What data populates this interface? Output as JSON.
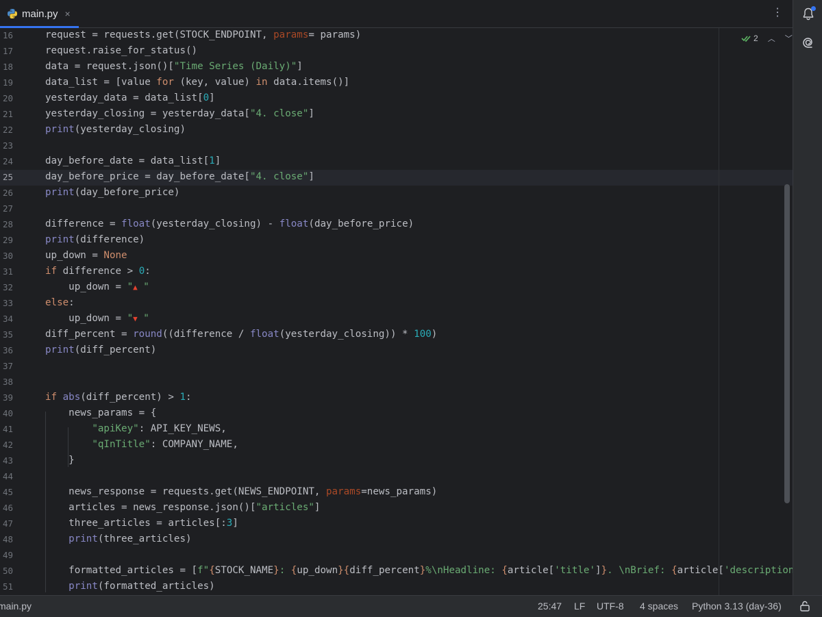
{
  "tab": {
    "label": "main.py",
    "close": "×"
  },
  "toolbar": {
    "more": "⋮"
  },
  "inspections": {
    "count": "2"
  },
  "status": {
    "file": "main.py",
    "position": "25:47",
    "line_sep": "LF",
    "encoding": "UTF-8",
    "indent": "4 spaces",
    "interpreter": "Python 3.13 (day-36)"
  },
  "editor": {
    "current_line": 25,
    "lines": [
      {
        "n": "16",
        "t": [
          [
            "request = requests.get(STOCK_ENDPOINT, ",
            ""
          ],
          [
            "params",
            "prm"
          ],
          [
            "= params)",
            ""
          ]
        ]
      },
      {
        "n": "17",
        "t": [
          [
            "request.raise_for_status()",
            ""
          ]
        ]
      },
      {
        "n": "18",
        "t": [
          [
            "data = request.json()[",
            ""
          ],
          [
            "\"Time Series (Daily)\"",
            "str"
          ],
          [
            "]",
            ""
          ]
        ]
      },
      {
        "n": "19",
        "t": [
          [
            "data_list = [value ",
            ""
          ],
          [
            "for",
            "kw"
          ],
          [
            " (key, value) ",
            ""
          ],
          [
            "in",
            "kw"
          ],
          [
            " data.items()]",
            ""
          ]
        ]
      },
      {
        "n": "20",
        "t": [
          [
            "yesterday_data = data_list[",
            ""
          ],
          [
            "0",
            "num"
          ],
          [
            "]",
            ""
          ]
        ]
      },
      {
        "n": "21",
        "t": [
          [
            "yesterday_closing = yesterday_data[",
            ""
          ],
          [
            "\"4. close\"",
            "str"
          ],
          [
            "]",
            ""
          ]
        ]
      },
      {
        "n": "22",
        "t": [
          [
            "print",
            "fn"
          ],
          [
            "(yesterday_closing)",
            ""
          ]
        ]
      },
      {
        "n": "23",
        "t": []
      },
      {
        "n": "24",
        "t": [
          [
            "day_before_date = data_list[",
            ""
          ],
          [
            "1",
            "num"
          ],
          [
            "]",
            ""
          ]
        ]
      },
      {
        "n": "25",
        "t": [
          [
            "day_before_price = day_before_date[",
            ""
          ],
          [
            "\"4. close\"",
            "str"
          ],
          [
            "]",
            ""
          ]
        ]
      },
      {
        "n": "26",
        "t": [
          [
            "print",
            "fn"
          ],
          [
            "(day_before_price)",
            ""
          ]
        ]
      },
      {
        "n": "27",
        "t": []
      },
      {
        "n": "28",
        "t": [
          [
            "difference = ",
            ""
          ],
          [
            "float",
            "fn"
          ],
          [
            "(yesterday_closing) - ",
            ""
          ],
          [
            "float",
            "fn"
          ],
          [
            "(day_before_price)",
            ""
          ]
        ]
      },
      {
        "n": "29",
        "t": [
          [
            "print",
            "fn"
          ],
          [
            "(difference)",
            ""
          ]
        ]
      },
      {
        "n": "30",
        "t": [
          [
            "up_down = ",
            ""
          ],
          [
            "None",
            "kw"
          ]
        ]
      },
      {
        "n": "31",
        "t": [
          [
            "if",
            "kw"
          ],
          [
            " difference > ",
            ""
          ],
          [
            "0",
            "num"
          ],
          [
            ":",
            ""
          ]
        ]
      },
      {
        "n": "32",
        "t": [
          [
            "    up_down = ",
            ""
          ],
          [
            "\"",
            "str"
          ],
          [
            "▲",
            "tri"
          ],
          [
            " \"",
            "str"
          ]
        ]
      },
      {
        "n": "33",
        "t": [
          [
            "else",
            "kw"
          ],
          [
            ":",
            ""
          ]
        ]
      },
      {
        "n": "34",
        "t": [
          [
            "    up_down = ",
            ""
          ],
          [
            "\"",
            "str"
          ],
          [
            "▼",
            "tri"
          ],
          [
            " \"",
            "str"
          ]
        ]
      },
      {
        "n": "35",
        "t": [
          [
            "diff_percent = ",
            ""
          ],
          [
            "round",
            "fn"
          ],
          [
            "((difference / ",
            ""
          ],
          [
            "float",
            "fn"
          ],
          [
            "(yesterday_closing)) * ",
            ""
          ],
          [
            "100",
            "num"
          ],
          [
            ")",
            ""
          ]
        ]
      },
      {
        "n": "36",
        "t": [
          [
            "print",
            "fn"
          ],
          [
            "(diff_percent)",
            ""
          ]
        ]
      },
      {
        "n": "37",
        "t": []
      },
      {
        "n": "38",
        "t": []
      },
      {
        "n": "39",
        "t": [
          [
            "if",
            "kw"
          ],
          [
            " ",
            ""
          ],
          [
            "abs",
            "fn"
          ],
          [
            "(diff_percent) > ",
            ""
          ],
          [
            "1",
            "num"
          ],
          [
            ":",
            ""
          ]
        ]
      },
      {
        "n": "40",
        "t": [
          [
            "    news_params = {",
            ""
          ]
        ]
      },
      {
        "n": "41",
        "t": [
          [
            "        ",
            ""
          ],
          [
            "\"apiKey\"",
            "str"
          ],
          [
            ": API_KEY_NEWS,",
            ""
          ]
        ]
      },
      {
        "n": "42",
        "t": [
          [
            "        ",
            ""
          ],
          [
            "\"qInTitle\"",
            "str"
          ],
          [
            ": COMPANY_NAME,",
            ""
          ]
        ]
      },
      {
        "n": "43",
        "t": [
          [
            "    }",
            ""
          ]
        ]
      },
      {
        "n": "44",
        "t": []
      },
      {
        "n": "45",
        "t": [
          [
            "    news_response = requests.get(NEWS_ENDPOINT, ",
            ""
          ],
          [
            "params",
            "prm"
          ],
          [
            "=news_params)",
            ""
          ]
        ]
      },
      {
        "n": "46",
        "t": [
          [
            "    articles = news_response.json()[",
            ""
          ],
          [
            "\"articles\"",
            "str"
          ],
          [
            "]",
            ""
          ]
        ]
      },
      {
        "n": "47",
        "t": [
          [
            "    three_articles = articles[:",
            ""
          ],
          [
            "3",
            "num"
          ],
          [
            "]",
            ""
          ]
        ]
      },
      {
        "n": "48",
        "t": [
          [
            "    ",
            ""
          ],
          [
            "print",
            "fn"
          ],
          [
            "(three_articles)",
            ""
          ]
        ]
      },
      {
        "n": "49",
        "t": []
      },
      {
        "n": "50",
        "t": [
          [
            "    formatted_articles = [",
            ""
          ],
          [
            "f\"",
            "str"
          ],
          [
            "{",
            "kw"
          ],
          [
            "STOCK_NAME",
            ""
          ],
          [
            "}",
            "kw"
          ],
          [
            ": ",
            "str"
          ],
          [
            "{",
            "kw"
          ],
          [
            "up_down",
            ""
          ],
          [
            "}{",
            "kw"
          ],
          [
            "diff_percent",
            ""
          ],
          [
            "}",
            "kw"
          ],
          [
            "%\\nHeadline: ",
            "str"
          ],
          [
            "{",
            "kw"
          ],
          [
            "article[",
            ""
          ],
          [
            "'title'",
            "str"
          ],
          [
            "]",
            ""
          ],
          [
            "}",
            "kw"
          ],
          [
            ". \\nBrief: ",
            "str"
          ],
          [
            "{",
            "kw"
          ],
          [
            "article[",
            ""
          ],
          [
            "'description'",
            "str"
          ],
          [
            "]",
            ""
          ],
          [
            "}",
            "kw"
          ],
          [
            "\"",
            "str"
          ]
        ]
      },
      {
        "n": "51",
        "t": [
          [
            "    ",
            ""
          ],
          [
            "print",
            "fn"
          ],
          [
            "(formatted_articles)",
            ""
          ]
        ]
      }
    ]
  }
}
